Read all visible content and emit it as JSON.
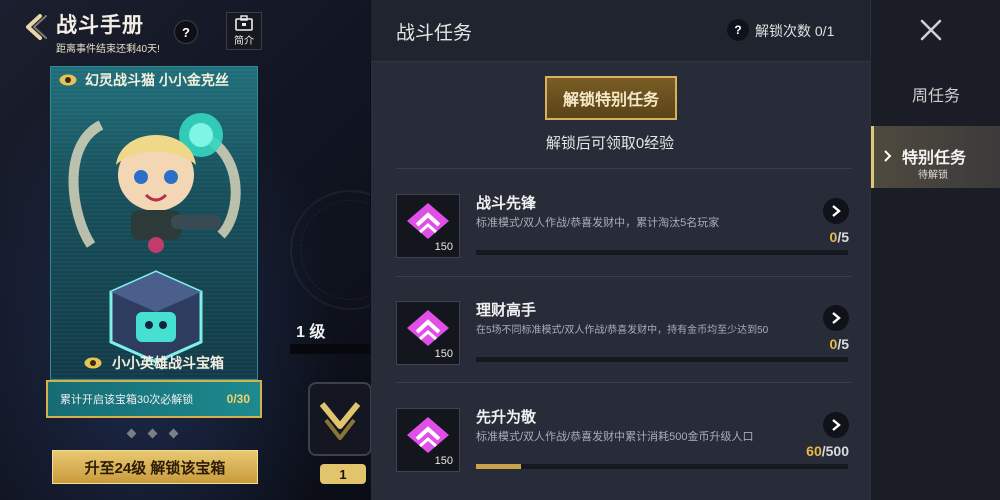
{
  "header": {
    "title": "战斗手册",
    "subtitle": "距离事件结束还剩40天!",
    "help": "?",
    "intro_label": "简介"
  },
  "reward_card": {
    "skin_name": "幻灵战斗猫 小小金克丝",
    "chest_name": "小小英雄战斗宝箱",
    "progress_text": "累计开启该宝箱30次必解锁",
    "progress_count": "0/30",
    "upgrade_button": "升至24级 解锁该宝箱"
  },
  "level": {
    "label": "1 级",
    "badge_number": "1"
  },
  "panel": {
    "title": "战斗任务",
    "help": "?",
    "unlock_count": "解锁次数 0/1",
    "special_button": "解锁特别任务",
    "exp_note": "解锁后可领取0经验"
  },
  "tasks": [
    {
      "name": "战斗先锋",
      "desc": "标准模式/双人作战/恭喜发财中，累计淘汰5名玩家",
      "reward": "150",
      "current": "0",
      "total": "/5",
      "fraction": 0
    },
    {
      "name": "理财高手",
      "desc": "在5场不同标准模式/双人作战/恭喜发财中，持有金币均至少达到50",
      "reward": "150",
      "current": "0",
      "total": "/5",
      "fraction": 0
    },
    {
      "name": "先升为敬",
      "desc": "标准模式/双人作战/恭喜发财中累计消耗500金币升级人口",
      "reward": "150",
      "current": "60",
      "total": "/500",
      "fraction": 0.12
    }
  ],
  "tabs": {
    "weekly": "周任务",
    "special": "特别任务",
    "special_status": "待解锁"
  },
  "colors": {
    "gold": "#c9a44c",
    "teal": "#1c8a8f",
    "panel": "#272c38",
    "diamond": "#e04fe6"
  }
}
